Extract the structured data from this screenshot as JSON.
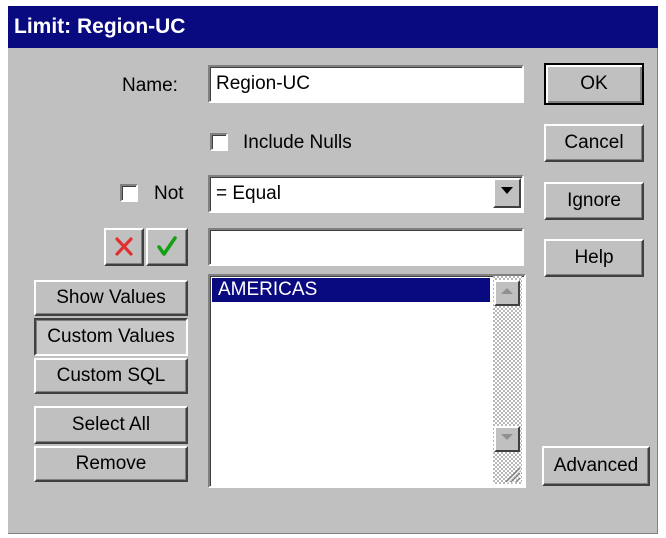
{
  "window": {
    "title": "Limit: Region-UC"
  },
  "name_field": {
    "label": "Name:",
    "value": "Region-UC"
  },
  "include_nulls": {
    "label": "Include Nulls",
    "checked": false
  },
  "not_option": {
    "label": "Not",
    "checked": false
  },
  "operator": {
    "selected": "= Equal"
  },
  "value_input": {
    "value": ""
  },
  "icons": {
    "cancel": "x-icon",
    "confirm": "checkmark-icon"
  },
  "colors": {
    "title_bar": "#0a0a80",
    "selection": "#0a0a80",
    "x_icon": "#e03030",
    "check_icon": "#14a014"
  },
  "values_list": {
    "items": [
      "AMERICAS"
    ],
    "selected_index": 0
  },
  "left_buttons": {
    "show_values": "Show Values",
    "custom_values": "Custom Values",
    "custom_sql": "Custom SQL",
    "select_all": "Select All",
    "remove": "Remove"
  },
  "right_buttons": {
    "ok": "OK",
    "cancel": "Cancel",
    "ignore": "Ignore",
    "help": "Help",
    "advanced": "Advanced"
  }
}
